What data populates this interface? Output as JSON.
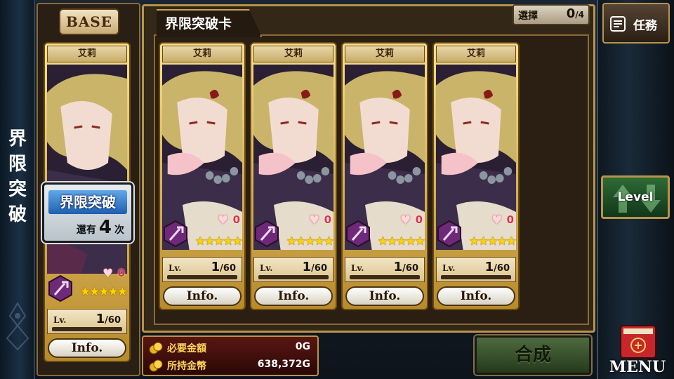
{
  "side_banner": {
    "title": "界限突破"
  },
  "base": {
    "tag": "BASE",
    "card": {
      "name": "艾莉",
      "hearts": "0",
      "stars": "★★★★★",
      "level_label": "Lv.",
      "level": "1",
      "level_max": "/60",
      "info_label": "Info."
    },
    "limit_break": {
      "title": "界限突破",
      "remain_prefix": "還有",
      "remain_count": "4",
      "remain_suffix": "次"
    }
  },
  "panel": {
    "title": "界限突破卡",
    "selection": {
      "label": "選擇",
      "value": "0",
      "max": "/4"
    },
    "cards": [
      {
        "name": "艾莉",
        "hearts": "0",
        "stars": "★★★★★",
        "level_label": "Lv.",
        "level": "1",
        "level_max": "/60",
        "info_label": "Info."
      },
      {
        "name": "艾莉",
        "hearts": "0",
        "stars": "★★★★★",
        "level_label": "Lv.",
        "level": "1",
        "level_max": "/60",
        "info_label": "Info."
      },
      {
        "name": "艾莉",
        "hearts": "0",
        "stars": "★★★★★",
        "level_label": "Lv.",
        "level": "1",
        "level_max": "/60",
        "info_label": "Info."
      },
      {
        "name": "艾莉",
        "hearts": "0",
        "stars": "★★★★★",
        "level_label": "Lv.",
        "level": "1",
        "level_max": "/60",
        "info_label": "Info."
      }
    ]
  },
  "gold": {
    "required_label": "必要金額",
    "required_value": "0G",
    "owned_label": "所持金幣",
    "owned_value": "638,372G"
  },
  "compose_button": "合成",
  "right": {
    "mission_label": "任務",
    "level_label": "Level",
    "menu_label": "MENU"
  },
  "colors": {
    "frame_gold": "#b8934a",
    "limit_break_blue": "#1f5fb0",
    "star_yellow": "#ffd200",
    "gold_text": "#ffd75a",
    "compose_green": "#2e4a26"
  }
}
